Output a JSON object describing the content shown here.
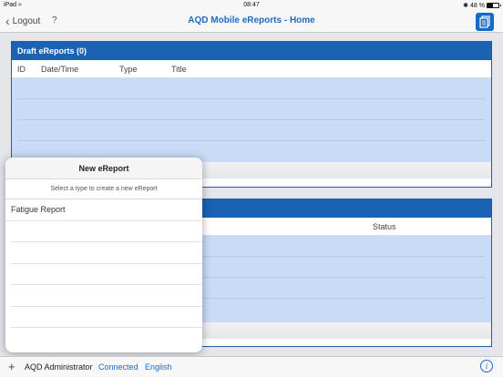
{
  "status_bar": {
    "device": "iPad",
    "time": "08:47",
    "battery": "48 %",
    "battery_level": 0.48
  },
  "nav": {
    "back_label": "Logout",
    "help_label": "?",
    "title": "AQD Mobile eReports - Home"
  },
  "draft_panel": {
    "title": "Draft eReports (0)",
    "columns": [
      "ID",
      "Date/Time",
      "Type",
      "Title"
    ]
  },
  "second_panel": {
    "columns": [
      "Status"
    ]
  },
  "popover": {
    "title": "New eReport",
    "subtitle": "Select a type to create a new eReport",
    "items": [
      "Fatigue Report"
    ]
  },
  "toolbar": {
    "add_label": "+",
    "user": "AQD Administrator",
    "connection": "Connected",
    "language": "English",
    "info_label": "i"
  },
  "colors": {
    "accent": "#1a6cc8",
    "header_blue": "#1a62b4",
    "row_blue": "#c9dbf7"
  }
}
